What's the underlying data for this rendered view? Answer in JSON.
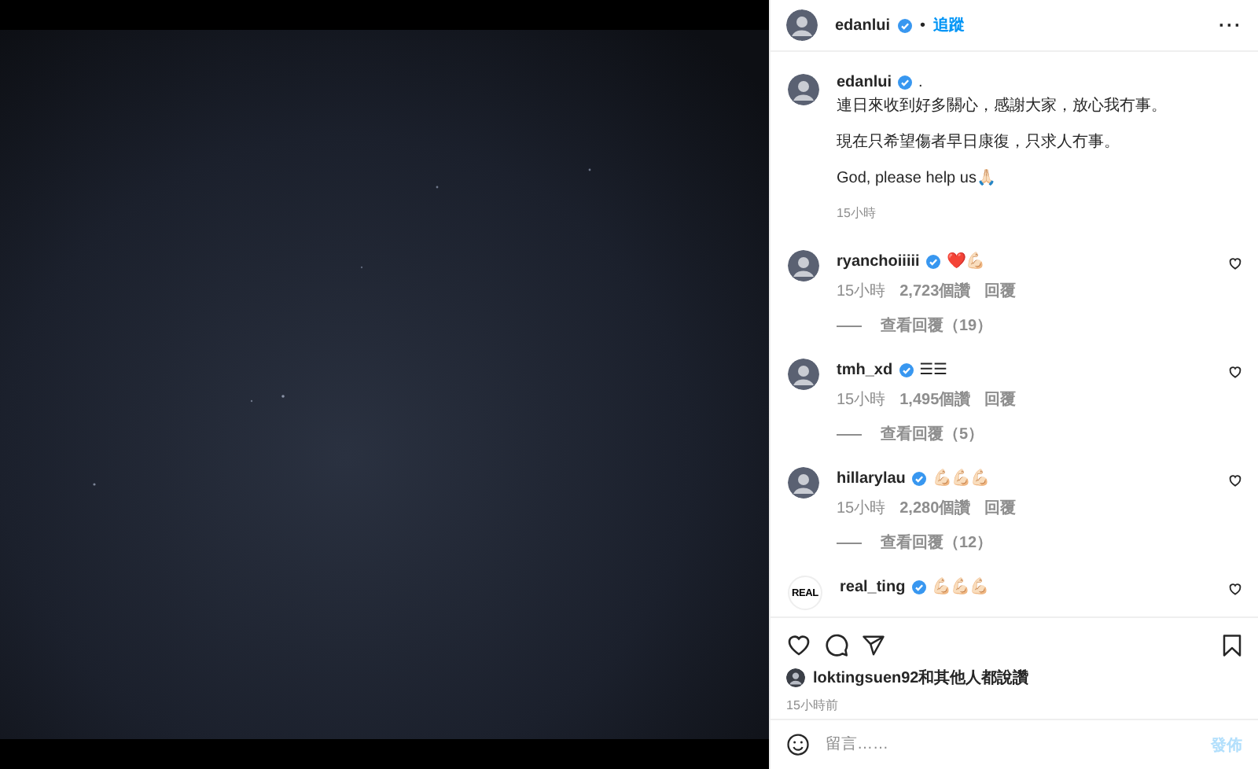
{
  "header": {
    "username": "edanlui",
    "verified": true,
    "separator": "•",
    "follow": "追蹤",
    "more": "···"
  },
  "caption": {
    "username": "edanlui",
    "verified": true,
    "suffix": ".",
    "paragraphs": [
      "連日來收到好多關心，感謝大家，放心我冇事。",
      "現在只希望傷者早日康復，只求人冇事。",
      "God, please help us🙏🏻"
    ],
    "time": "15小時"
  },
  "comments": [
    {
      "username": "ryanchoiiiii",
      "verified": true,
      "text": "❤️💪🏻",
      "time": "15小時",
      "likes": "2,723個讚",
      "reply": "回覆",
      "view_replies": "查看回覆（19）"
    },
    {
      "username": "tmh_xd",
      "verified": true,
      "text": "☰☰",
      "time": "15小時",
      "likes": "1,495個讚",
      "reply": "回覆",
      "view_replies": "查看回覆（5）"
    },
    {
      "username": "hillarylau",
      "verified": true,
      "text": "💪🏻💪🏻💪🏻",
      "time": "15小時",
      "likes": "2,280個讚",
      "reply": "回覆",
      "view_replies": "查看回覆（12）"
    },
    {
      "username": "real_ting",
      "verified": true,
      "avatar_label": "REAL",
      "text": "💪🏻💪🏻💪🏻"
    }
  ],
  "liked_by": "loktingsuen92和其他人都說讚",
  "posted": "15小時前",
  "comment_box": {
    "placeholder": "留言……",
    "post": "發佈"
  }
}
